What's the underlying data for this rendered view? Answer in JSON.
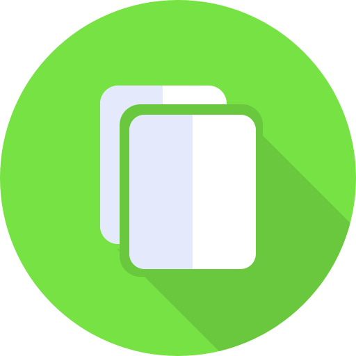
{
  "icon": {
    "name": "copy-documents-icon",
    "colors": {
      "circle": "#76e244",
      "long_shadow": "#69c83d",
      "page_light": "#e4e9fb",
      "page_white": "#ffffff",
      "front_page_border": "#69c83d"
    }
  }
}
